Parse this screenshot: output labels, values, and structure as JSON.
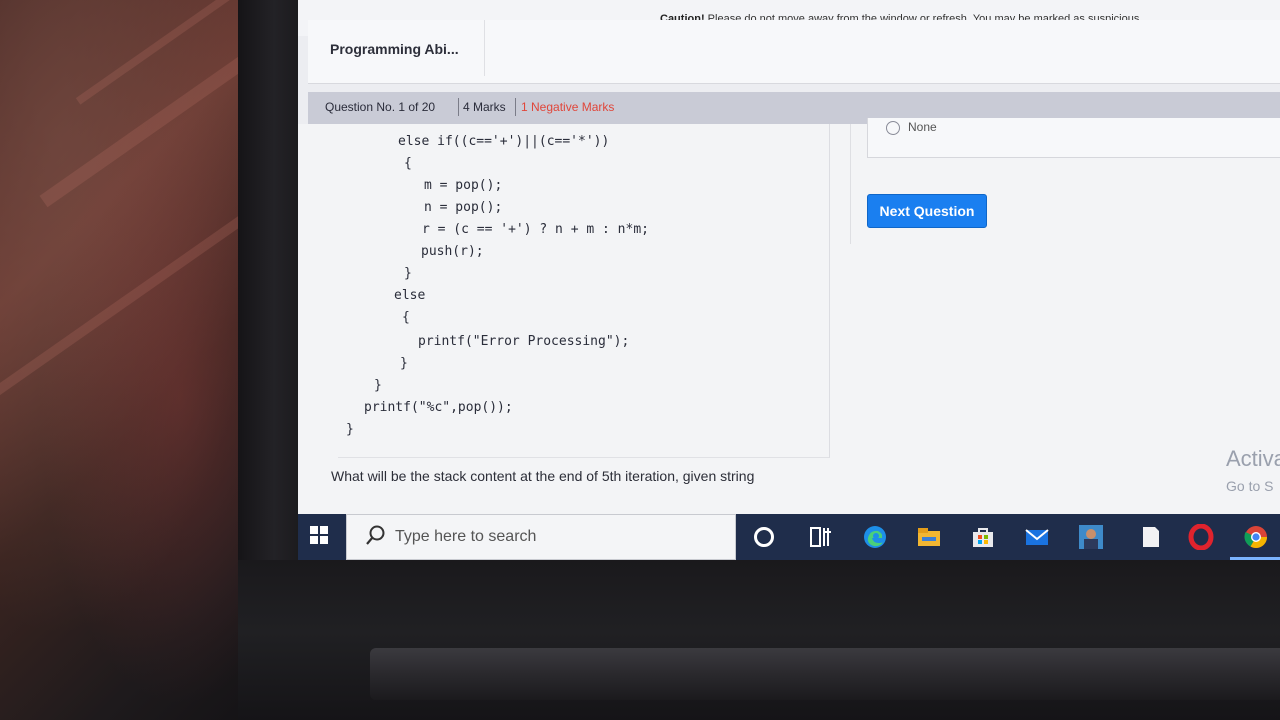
{
  "warning": {
    "caution_label": "Caution!",
    "message": "Please do not move away from the window or refresh. You may be marked as suspicious"
  },
  "header": {
    "app_name": "Programming Abi..."
  },
  "question_bar": {
    "number": "Question No. 1 of 20",
    "marks": "4 Marks",
    "negative": "1 Negative Marks"
  },
  "code_lines": [
    "else if((c=='+')||(c=='*'))",
    "{",
    "m = pop();",
    "n = pop();",
    "r = (c == '+') ? n + m : n*m;",
    "push(r);",
    "}",
    "else",
    "{",
    "printf(\"Error Processing\");",
    "}",
    "}",
    "printf(\"%c\",pop());",
    "}"
  ],
  "question_text": "What will be the stack content at the end of 5th iteration, given string",
  "option": {
    "label": "None"
  },
  "next_button": {
    "label": "Next Question"
  },
  "activation": {
    "line1": "Activa",
    "line2": "Go to S"
  },
  "taskbar": {
    "search_placeholder": "Type here to search",
    "colors": {
      "background": "#1f2d4b",
      "accent": "#1a7ff0"
    }
  }
}
